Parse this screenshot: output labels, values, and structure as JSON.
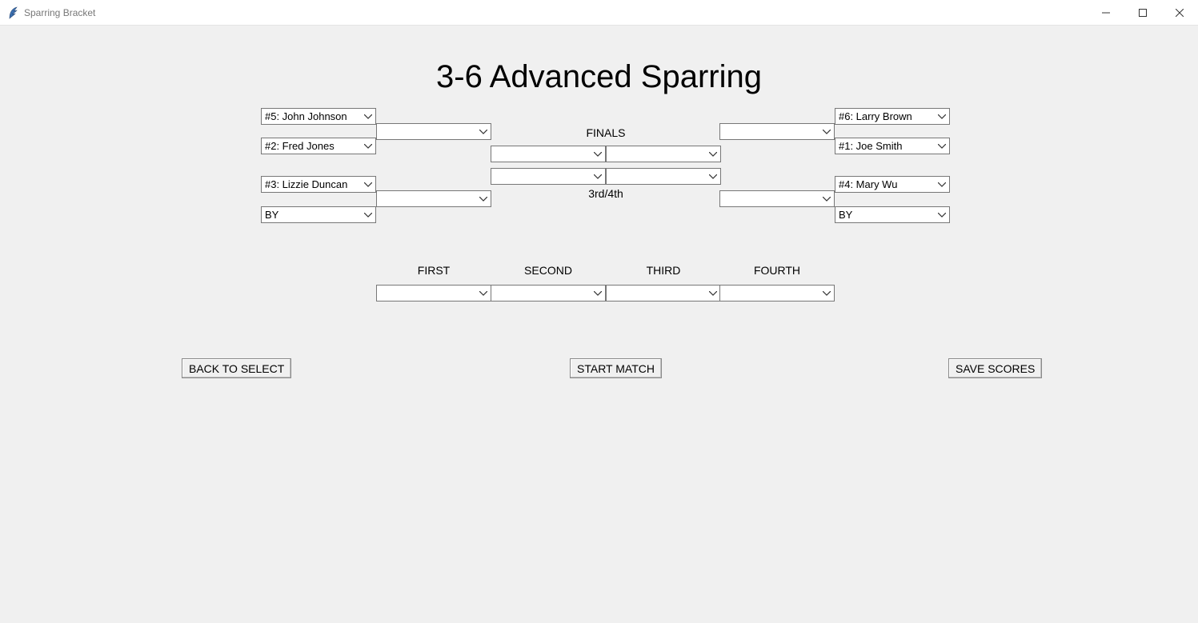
{
  "window": {
    "title": "Sparring Bracket"
  },
  "heading": "3-6 Advanced Sparring",
  "labels": {
    "finals": "FINALS",
    "third_fourth": "3rd/4th",
    "first": "FIRST",
    "second": "SECOND",
    "third": "THIRD",
    "fourth": "FOURTH"
  },
  "bracket": {
    "left_r1_a": "#5: John Johnson",
    "left_r1_b": "#2: Fred Jones",
    "left_r1_c": "#3: Lizzie Duncan",
    "left_r1_d": "BY",
    "left_r2_a": "",
    "left_r2_b": "",
    "right_r1_a": "#6: Larry Brown",
    "right_r1_b": "#1: Joe Smith",
    "right_r1_c": "#4: Mary Wu",
    "right_r1_d": "BY",
    "right_r2_a": "",
    "right_r2_b": "",
    "final_left": "",
    "final_right": "",
    "third_left": "",
    "third_right": ""
  },
  "places": {
    "first": "",
    "second": "",
    "third": "",
    "fourth": ""
  },
  "buttons": {
    "back": "BACK TO SELECT",
    "start": "START MATCH",
    "save": "SAVE SCORES"
  }
}
